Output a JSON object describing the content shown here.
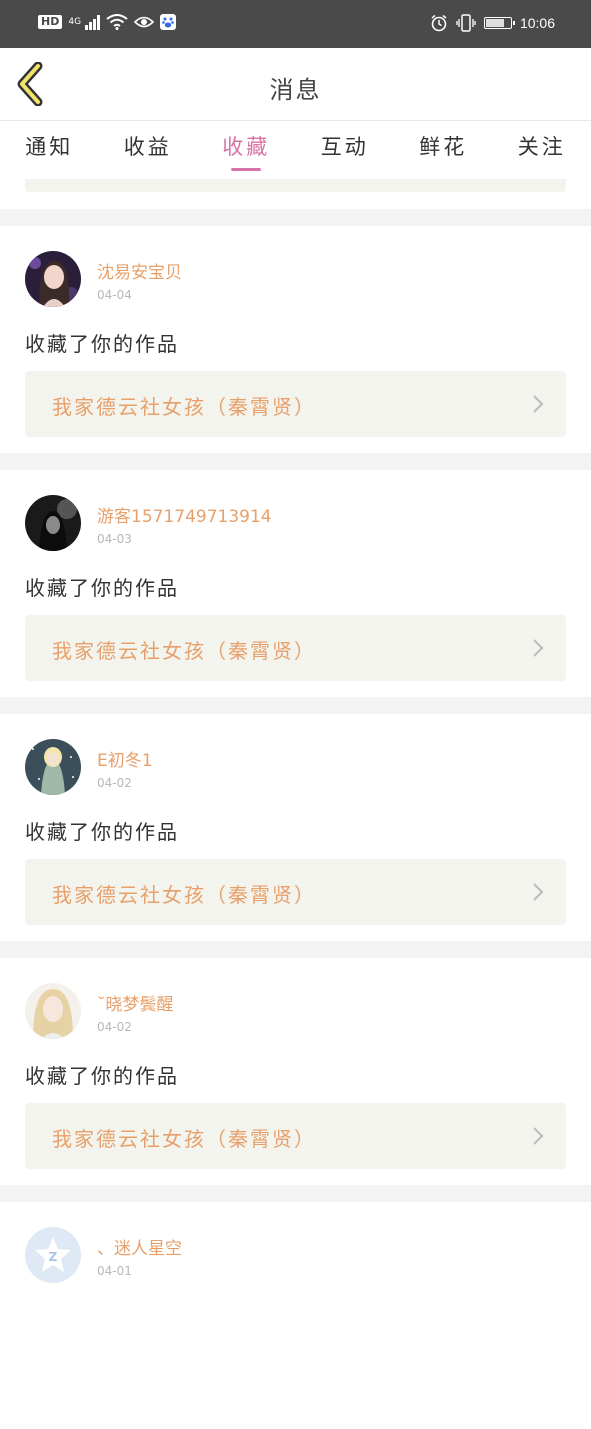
{
  "status_bar": {
    "network": "4G",
    "hd": "HD",
    "time": "10:06"
  },
  "header": {
    "title": "消息",
    "back_icon": "chevron-left-icon"
  },
  "tabs": [
    {
      "label": "通知",
      "active": false
    },
    {
      "label": "收益",
      "active": false
    },
    {
      "label": "收藏",
      "active": true
    },
    {
      "label": "互动",
      "active": false
    },
    {
      "label": "鲜花",
      "active": false
    },
    {
      "label": "关注",
      "active": false
    }
  ],
  "items": [
    {
      "name": "沈易安宝贝",
      "date": "04-04",
      "message": "收藏了你的作品",
      "work": "我家德云社女孩（秦霄贤）"
    },
    {
      "name": "游客1571749713914",
      "date": "04-03",
      "message": "收藏了你的作品",
      "work": "我家德云社女孩（秦霄贤）"
    },
    {
      "name": "E初冬1",
      "date": "04-02",
      "message": "收藏了你的作品",
      "work": "我家德云社女孩（秦霄贤）"
    },
    {
      "name": "˘晓梦鬓醒",
      "date": "04-02",
      "message": "收藏了你的作品",
      "work": "我家德云社女孩（秦霄贤）"
    },
    {
      "name": "、迷人星空",
      "date": "04-01"
    }
  ],
  "colors": {
    "accent": "#d973a6",
    "name": "#e8a06a",
    "card_bg": "#f4f4ee"
  }
}
